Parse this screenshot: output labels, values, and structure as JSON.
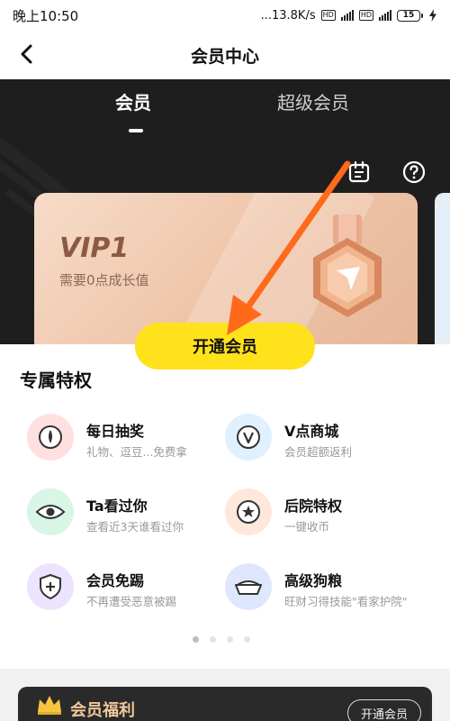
{
  "status_bar": {
    "time": "晚上10:50",
    "network_speed": "...13.8K/s",
    "hd_label": "HD",
    "battery": "15"
  },
  "header": {
    "title": "会员中心"
  },
  "tabs": [
    {
      "label": "会员",
      "active": true
    },
    {
      "label": "超级会员",
      "active": false
    }
  ],
  "vip_card": {
    "level": "VIP1",
    "description": "需要0点成长值"
  },
  "open_button": {
    "label": "开通会员"
  },
  "privileges": {
    "title": "专属特权",
    "items": [
      {
        "name": "每日抽奖",
        "desc": "礼物、逗豆...免费拿",
        "icon": "lottery-icon",
        "color": "#ffe0e0"
      },
      {
        "name": "V点商城",
        "desc": "会员超额返利",
        "icon": "v-coin-icon",
        "color": "#dff0ff"
      },
      {
        "name": "Ta看过你",
        "desc": "查看近3天谁看过你",
        "icon": "eye-icon",
        "color": "#d8f5e6"
      },
      {
        "name": "后院特权",
        "desc": "一键收币",
        "icon": "star-coin-icon",
        "color": "#ffe7dc"
      },
      {
        "name": "会员免踢",
        "desc": "不再遭受恶意被踢",
        "icon": "shield-plus-icon",
        "color": "#ece3ff"
      },
      {
        "name": "高级狗粮",
        "desc": "旺财习得技能\"看家护院\"",
        "icon": "dog-bowl-icon",
        "color": "#dfe7ff"
      }
    ],
    "page_count": 4,
    "active_page": 0
  },
  "welfare": {
    "title": "会员福利",
    "button_label": "开通会员"
  },
  "colors": {
    "accent_yellow": "#ffe21c",
    "dark_bg": "#1e1e1e",
    "annotation_arrow": "#ff6a1a"
  }
}
